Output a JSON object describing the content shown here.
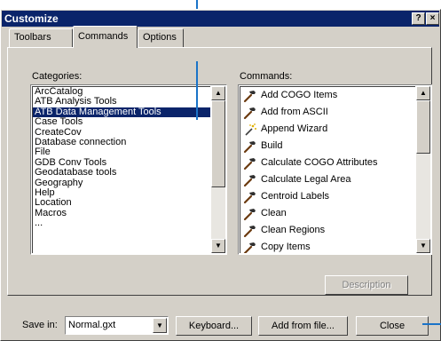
{
  "dialog": {
    "title": "Customize",
    "help_btn": "?",
    "close_btn": "×"
  },
  "tabs": [
    {
      "label": "Toolbars",
      "active": false
    },
    {
      "label": "Commands",
      "active": true
    },
    {
      "label": "Options",
      "active": false
    }
  ],
  "categories": {
    "label": "Categories:",
    "selected": "ATB Data Management Tools",
    "items": [
      "ArcCatalog",
      "ATB Analysis Tools",
      "ATB Data Management Tools",
      "Case Tools",
      "CreateCov",
      "Database connection",
      "File",
      "GDB Conv Tools",
      "Geodatabase tools",
      "Geography",
      "Help",
      "Location",
      "Macros",
      "..."
    ]
  },
  "commands": {
    "label": "Commands:",
    "items": [
      {
        "label": "Add COGO Items",
        "icon": "hammer-icon"
      },
      {
        "label": "Add from ASCII",
        "icon": "hammer-icon"
      },
      {
        "label": "Append Wizard",
        "icon": "wizard-wand-icon"
      },
      {
        "label": "Build",
        "icon": "hammer-icon"
      },
      {
        "label": "Calculate COGO Attributes",
        "icon": "hammer-icon"
      },
      {
        "label": "Calculate Legal Area",
        "icon": "hammer-icon"
      },
      {
        "label": "Centroid Labels",
        "icon": "hammer-icon"
      },
      {
        "label": "Clean",
        "icon": "hammer-icon"
      },
      {
        "label": "Clean Regions",
        "icon": "hammer-icon"
      },
      {
        "label": "Copy Items",
        "icon": "hammer-icon"
      }
    ]
  },
  "description_btn": "Description",
  "footer": {
    "save_in_label": "Save in:",
    "save_in_value": "Normal.gxt",
    "keyboard_btn": "Keyboard...",
    "add_from_file_btn": "Add from file...",
    "close_btn": "Close"
  },
  "colors": {
    "callout": "#1a73c8",
    "titlebar": "#0a246a",
    "selection": "#0a246a",
    "face": "#d4d0c8"
  }
}
